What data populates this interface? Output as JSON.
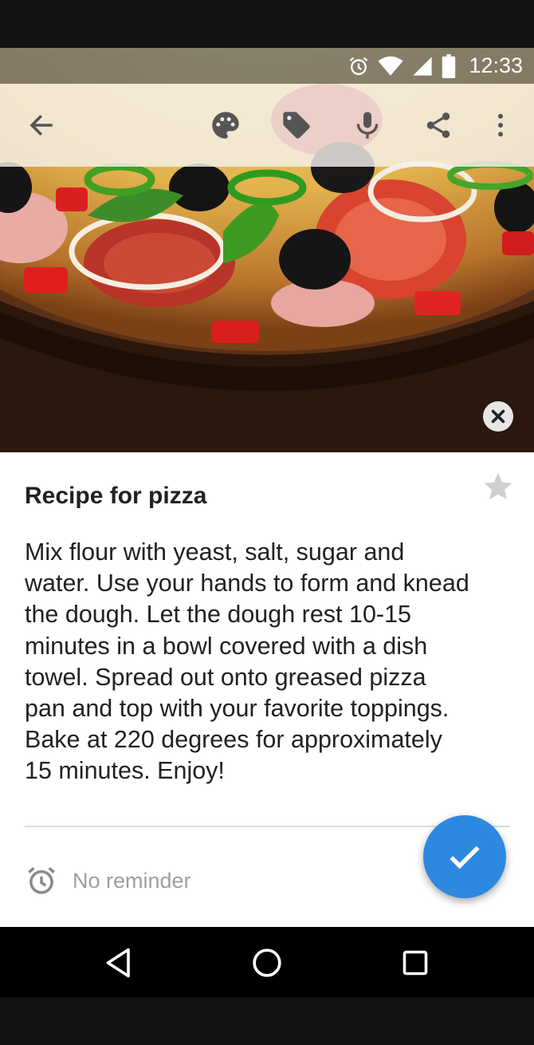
{
  "status_bar": {
    "time": "12:33",
    "icons": [
      "alarm-icon",
      "wifi-icon",
      "signal-icon",
      "battery-icon"
    ]
  },
  "toolbar": {
    "buttons": [
      "back-arrow-icon",
      "palette-icon",
      "label-icon",
      "microphone-icon",
      "share-icon",
      "more-vert-icon"
    ]
  },
  "image": {
    "alt": "Pizza photo",
    "remove_icon": "close-icon"
  },
  "note": {
    "title": "Recipe for pizza",
    "body": "Mix flour with yeast, salt, sugar and\nwater. Use your hands to form and knead\nthe dough. Let the dough rest 10-15\nminutes in a bowl covered with a dish\ntowel. Spread out onto greased pizza\npan and top with your favorite toppings.\nBake at 220 degrees for approximately\n15 minutes. Enjoy!",
    "starred": false
  },
  "reminder": {
    "label": "No reminder",
    "icon": "alarm-icon"
  },
  "fab": {
    "icon": "check-icon",
    "color": "#2d88e0"
  },
  "nav_bar": {
    "buttons": [
      "back-triangle-icon",
      "home-circle-icon",
      "recents-square-icon"
    ]
  }
}
